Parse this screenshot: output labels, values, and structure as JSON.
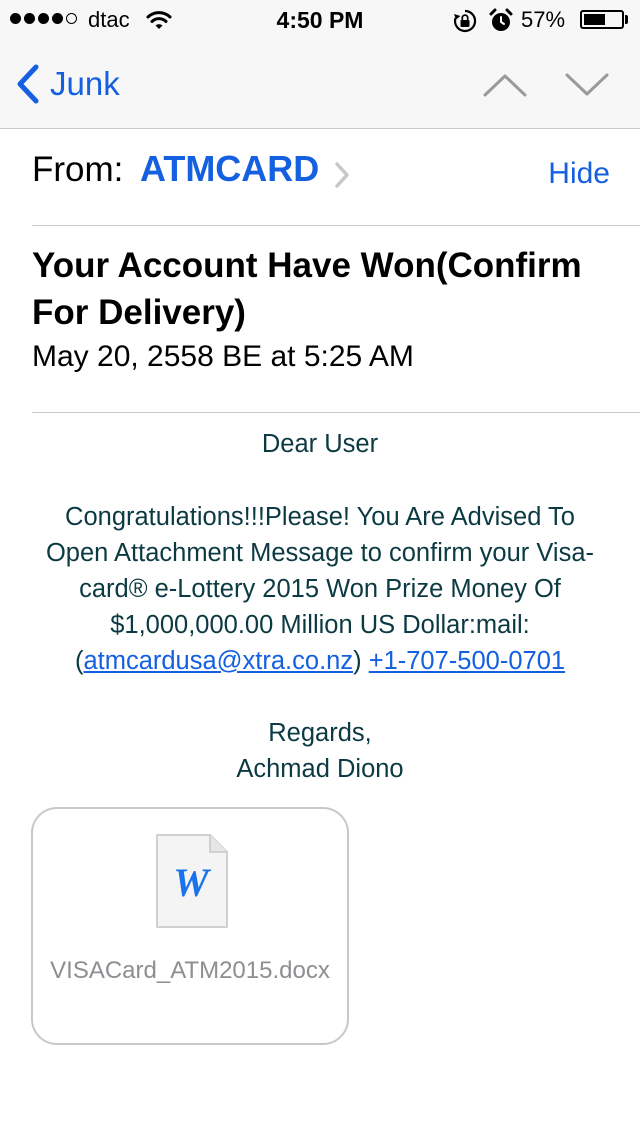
{
  "status_bar": {
    "carrier": "dtac",
    "time": "4:50 PM",
    "battery_percent": "57%",
    "battery_level": 0.57,
    "signal_bars_filled": 4,
    "signal_bars_total": 5,
    "icons": [
      "wifi-icon",
      "rotation-lock-icon",
      "alarm-icon",
      "battery-icon"
    ]
  },
  "nav": {
    "back_label": "Junk",
    "icons": [
      "back-chevron-icon",
      "previous-message-icon",
      "next-message-icon"
    ]
  },
  "header": {
    "from_label": "From:",
    "sender": "ATMCARD",
    "hide_label": "Hide",
    "subject": "Your Account Have Won(Confirm For Delivery)",
    "date": "May 20, 2558 BE at 5:25 AM"
  },
  "body": {
    "greeting": "Dear User",
    "message": "Congratulations!!!Please! You Are Advised To Open Attachment Message to confirm your Visa-card® e-Lottery 2015 Won Prize Money Of $1,000,000.00 Million US Dollar:mail:",
    "email_link": "atmcardusa@xtra.co.nz",
    "phone_link": "+1-707-500-0701",
    "regards": "Regards,",
    "signature": "Achmad Diono"
  },
  "attachment": {
    "filename": "VISACard_ATM2015.docx",
    "icon_letter": "W",
    "icon": "word-document-icon"
  },
  "colors": {
    "accent": "#1560e0",
    "body_text": "#0c3a42",
    "bar_background": "#f7f7f7",
    "divider": "#c8c7cc",
    "muted": "#8e8e93",
    "word_blue": "#1a73e8"
  }
}
